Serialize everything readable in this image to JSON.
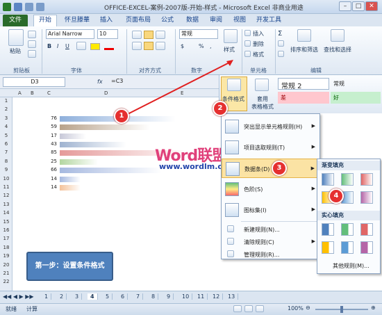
{
  "window": {
    "title": "OFFICE-EXCEL-案例-2007版-开始-样式 - Microsoft Excel 非商业用途",
    "min_label": "–",
    "max_label": "□",
    "close_label": "✕"
  },
  "ribbon_tabs": [
    "文件",
    "开始",
    "怀旦滕華",
    "插入",
    "页面布局",
    "公式",
    "数据",
    "审阅",
    "视图",
    "开发工具"
  ],
  "ribbon": {
    "paste_label": "粘贴",
    "clipboard_group": "剪贴板",
    "font_name": "Arial Narrow",
    "font_size": "10",
    "font_group": "字体",
    "align_group": "对齐方式",
    "number_format": "常规",
    "number_group": "数字",
    "style_label": "样式",
    "insert_label": "插入",
    "delete_label": "删除",
    "format_label": "格式",
    "cells_group": "单元格",
    "sort_label": "排序和筛选",
    "find_label": "查找和选择",
    "edit_group": "编辑"
  },
  "formula_bar": {
    "name_box": "D3",
    "fx": "fx",
    "formula": "=C3"
  },
  "grid": {
    "columns": [
      "A",
      "B",
      "C",
      "D",
      "E"
    ],
    "rows": [
      "1",
      "2",
      "3",
      "4",
      "5",
      "6",
      "7",
      "8",
      "9",
      "10",
      "11",
      "12",
      "13",
      "14",
      "15",
      "16",
      "17",
      "18",
      "19",
      "20",
      "21",
      "22"
    ],
    "values": [
      "76",
      "59",
      "17",
      "43",
      "85",
      "25",
      "66",
      "14",
      "14"
    ],
    "fill_levels": [
      0.89,
      0.69,
      0.2,
      0.51,
      1.0,
      0.29,
      0.78,
      0.16,
      0.16
    ],
    "bar_colors": [
      "#8fb0dc",
      "#b8a28a",
      "#c7c8d8",
      "#9fb3d0",
      "#e59a9a",
      "#b3d6a0",
      "#a6b9e0",
      "#a6b9e0",
      "#f4c29a"
    ]
  },
  "step_box": "第一步：设置条件格式",
  "watermark": {
    "word": "Word",
    "cn": "联盟",
    "url": "www.wordlm.com"
  },
  "cf_panel": {
    "cond_format": "条件格式",
    "table_format_1": "套用",
    "table_format_2": "表格格式",
    "style_normal2": "常规 2",
    "style_normal": "常规",
    "style_bad": "差",
    "style_good": "好"
  },
  "menu": {
    "items": [
      {
        "label": "突出显示单元格规则(H)"
      },
      {
        "label": "项目选取规则(T)"
      },
      {
        "label": "数据条(D)"
      },
      {
        "label": "色阶(S)"
      },
      {
        "label": "图标集(I)"
      }
    ],
    "small_items": [
      "新建规则(N)...",
      "清除规则(C)",
      "管理规则(R)..."
    ]
  },
  "submenu": {
    "gradient_header": "渐变填充",
    "solid_header": "实心填充",
    "more_rules": "其他规则(M)...",
    "swatch_colors": [
      "#4f81bd",
      "#63be7b",
      "#e06666",
      "#ffc000",
      "#5b9bd5",
      "#b565a7"
    ]
  },
  "annotations": [
    "1",
    "2",
    "3",
    "4"
  ],
  "sheet_tabs": [
    "1",
    "2",
    "3",
    "4",
    "5",
    "6",
    "7",
    "8",
    "9",
    "10",
    "11",
    "12",
    "13"
  ],
  "status": {
    "ready": "就绪",
    "calc": "计算",
    "zoom": "100%"
  }
}
